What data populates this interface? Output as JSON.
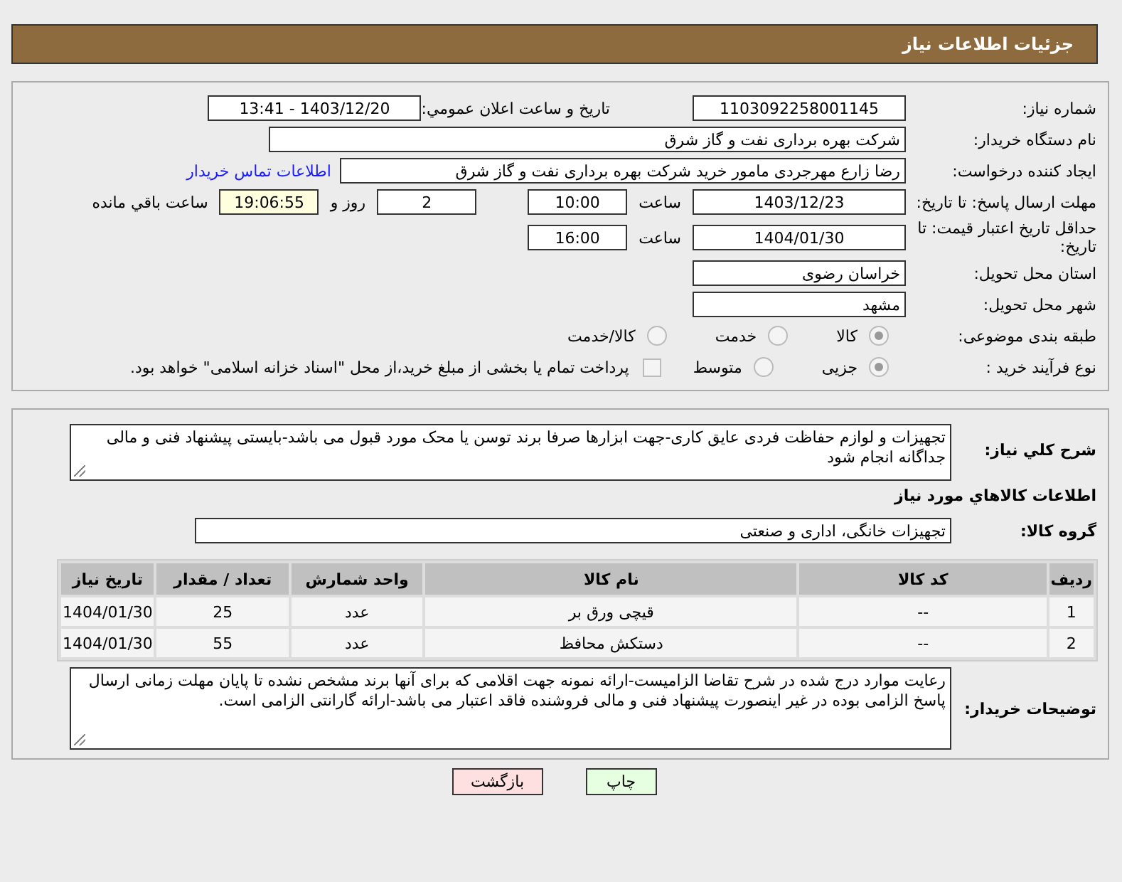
{
  "header": {
    "title": "جزئیات اطلاعات نیاز"
  },
  "details": {
    "need_number": {
      "label": "شماره نیاز:",
      "value": "1103092258001145"
    },
    "announce": {
      "label": "تاریخ و ساعت اعلان عمومي:",
      "value": "1403/12/20 - 13:41"
    },
    "buyer_org": {
      "label": "نام دستگاه خریدار:",
      "value": "شرکت بهره برداری نفت و گاز شرق"
    },
    "requester": {
      "label": "ایجاد کننده درخواست:",
      "value": "رضا زارع مهرجردی مامور خرید شرکت بهره برداری نفت و گاز شرق",
      "link": "اطلاعات تماس خریدار"
    },
    "reply_deadline": {
      "label": "مهلت ارسال پاسخ: تا تاریخ:",
      "date": "1403/12/23",
      "time_label": "ساعت",
      "time": "10:00",
      "days": "2",
      "days_label": "روز و",
      "remaining": "19:06:55",
      "remaining_label": "ساعت باقي مانده"
    },
    "validity": {
      "label": "حداقل تاریخ اعتبار قیمت: تا تاریخ:",
      "date": "1404/01/30",
      "time_label": "ساعت",
      "time": "16:00"
    },
    "province": {
      "label": "استان محل تحویل:",
      "value": "خراسان رضوی"
    },
    "city": {
      "label": "شهر محل تحویل:",
      "value": "مشهد"
    },
    "category": {
      "label": "طبقه بندی موضوعی:",
      "options": [
        {
          "label": "کالا",
          "selected": true
        },
        {
          "label": "خدمت",
          "selected": false
        },
        {
          "label": "کالا/خدمت",
          "selected": false
        }
      ]
    },
    "process": {
      "label": "نوع فرآیند خرید :",
      "options": [
        {
          "label": "جزیی",
          "selected": true
        },
        {
          "label": "متوسط",
          "selected": false
        }
      ],
      "payment": {
        "label": "پرداخت تمام یا بخشی از مبلغ خرید،از محل \"اسناد خزانه اسلامی\" خواهد بود.",
        "checked": false
      }
    }
  },
  "goods": {
    "summary": {
      "label": "شرح کلي نياز:",
      "value": "تجهیزات و لوازم حفاظت فردی عایق کاری-جهت ابزارها صرفا برند توسن یا محک مورد قبول می باشد-بایستی پیشنهاد فنی و مالی جداگانه انجام شود"
    },
    "heading": "اطلاعات کالاهاي مورد نياز",
    "group": {
      "label": "گروه کالا:",
      "value": "تجهیزات خانگی، اداری و صنعتی"
    },
    "table": {
      "columns": [
        "ردیف",
        "کد کالا",
        "نام کالا",
        "واحد شمارش",
        "تعداد / مقدار",
        "تاریخ نیاز"
      ],
      "rows": [
        [
          "1",
          "--",
          "قیچی ورق بر",
          "عدد",
          "25",
          "1404/01/30"
        ],
        [
          "2",
          "--",
          "دستکش محافظ",
          "عدد",
          "55",
          "1404/01/30"
        ]
      ]
    },
    "buyer_notes": {
      "label": "توضیحات خریدار:",
      "value": "رعایت موارد درج شده در شرح تقاضا الزامیست-ارائه نمونه جهت اقلامی که برای آنها برند مشخص نشده تا پایان مهلت زمانی ارسال پاسخ الزامی بوده در غیر اینصورت پیشنهاد فنی و مالی فروشنده فاقد اعتبار می باشد-ارائه گارانتی الزامی است."
    }
  },
  "buttons": [
    {
      "label": "چاپ",
      "kind": "print"
    },
    {
      "label": "بازگشت",
      "kind": "back"
    }
  ]
}
